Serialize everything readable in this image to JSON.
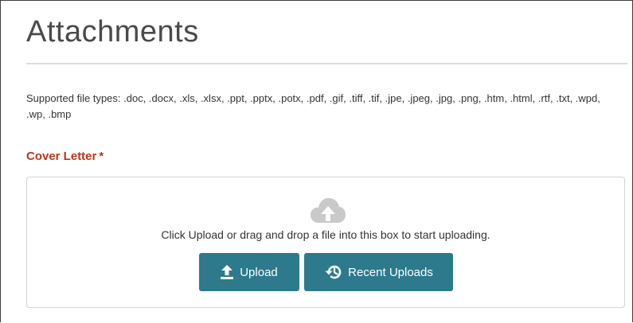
{
  "section": {
    "title": "Attachments",
    "supported_types": "Supported file types: .doc, .docx, .xls, .xlsx, .ppt, .pptx, .potx, .pdf, .gif, .tiff, .tif, .jpe, .jpeg, .jpg, .png, .htm, .html, .rtf, .txt, .wpd, .wp, .bmp"
  },
  "cover_letter": {
    "label": "Cover Letter",
    "required_marker": "*",
    "dropzone": {
      "icon": "cloud-upload-icon",
      "instruction": "Click Upload or drag and drop a file into this box to start uploading."
    },
    "buttons": {
      "upload": {
        "label": "Upload",
        "icon": "upload-arrow-icon"
      },
      "recent": {
        "label": "Recent Uploads",
        "icon": "history-icon"
      }
    }
  },
  "colors": {
    "label_red": "#b8361a",
    "button_teal": "#2c7a8c",
    "title_gray": "#4a4a4a"
  }
}
